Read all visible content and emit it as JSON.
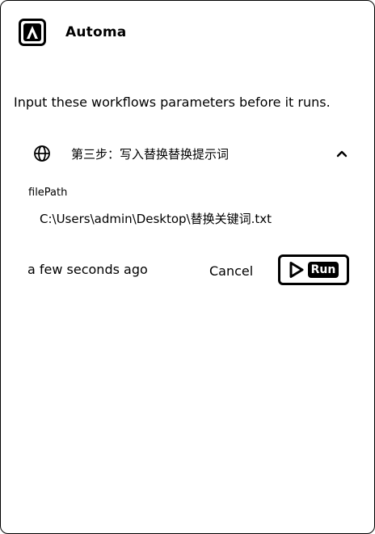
{
  "header": {
    "app_name": "Automa",
    "logo_icon": "automa-logo-icon"
  },
  "intro_text": "Input these workflows parameters before it runs.",
  "workflow": {
    "icon": "globe-icon",
    "name": "第三步：写入替换替换提示词",
    "expanded": true,
    "toggle_icon": "chevron-up-icon"
  },
  "parameter": {
    "label": "filePath",
    "value": "C:\\Users\\admin\\Desktop\\替换关键词.txt"
  },
  "footer": {
    "timestamp": "a few seconds ago",
    "cancel_label": "Cancel",
    "run_label": "Run",
    "run_icon": "play-icon"
  }
}
